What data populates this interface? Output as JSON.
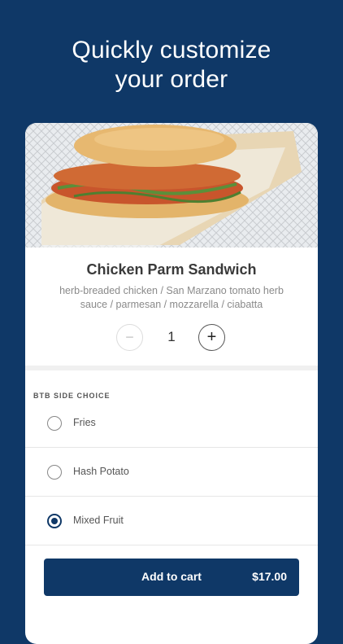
{
  "headline": {
    "line1": "Quickly customize",
    "line2": "your order"
  },
  "item": {
    "name": "Chicken Parm Sandwich",
    "description": "herb-breaded chicken / San Marzano tomato herb sauce / parmesan / mozzarella / ciabatta",
    "photo_alt": "Chicken Parm Sandwich photo"
  },
  "stepper": {
    "minus": "−",
    "quantity": "1",
    "plus": "+"
  },
  "side_choice": {
    "label": "BTB SIDE CHOICE",
    "options": [
      {
        "label": "Fries",
        "selected": false
      },
      {
        "label": "Hash Potato",
        "selected": false
      },
      {
        "label": "Mixed Fruit",
        "selected": true
      }
    ]
  },
  "cart": {
    "label": "Add to cart",
    "price": "$17.00"
  },
  "colors": {
    "brand": "#0f3867",
    "background": "#0f3867"
  }
}
